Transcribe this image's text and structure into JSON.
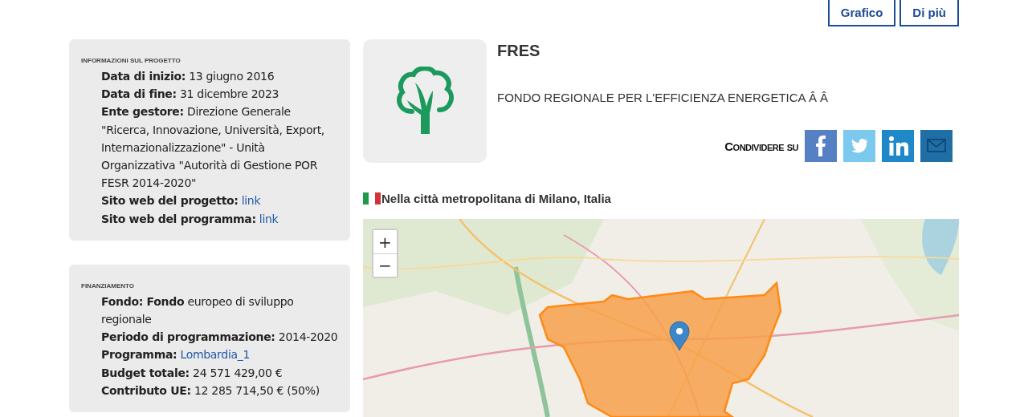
{
  "header_buttons": [
    "Grafico",
    "Di più"
  ],
  "project_info": {
    "heading": "INFORMAZIONI SUL PROGETTO",
    "rows": [
      {
        "kind": "text",
        "text": "**Data di inizio:** 13 giugno 2016"
      },
      {
        "kind": "text",
        "text": "**Data di fine:** 31 dicembre 2023"
      },
      {
        "kind": "text",
        "text": "**Ente gestore:** Direzione Generale \"Ricerca, Innovazione, Università, Export, Internazionalizzazione\" - Unità Organizzativa \"Autorità di Gestione POR FESR 2014-2020\""
      },
      {
        "kind": "link",
        "text": "**Sito web del progetto:**",
        "link": "link"
      },
      {
        "kind": "link",
        "text": "**Sito web del programma:**",
        "link": "link"
      }
    ]
  },
  "funding": {
    "heading": "FINANZIAMENTO",
    "rows": [
      {
        "kind": "text",
        "text": "**Fondo: Fondo** europeo di sviluppo regionale"
      },
      {
        "kind": "text",
        "text": "**Periodo di programmazione:** 2014-2020"
      },
      {
        "kind": "link",
        "text": "**Programma:**",
        "link": "Lombardia_1"
      },
      {
        "kind": "text",
        "text": "**Budget totale:** 24 571 429,00 €"
      },
      {
        "kind": "text",
        "text": "**Contributo UE:** 12 285 714,50 € (50%)"
      }
    ]
  },
  "project": {
    "title": "FRES",
    "description": "FONDO REGIONALE PER L'EFFICIENZA ENERGETICA Â Â"
  },
  "share": {
    "label": "Condividere su",
    "networks": [
      {
        "kind": "facebook"
      },
      {
        "kind": "twitter"
      },
      {
        "kind": "linkedin"
      },
      {
        "kind": "email"
      }
    ]
  },
  "location": {
    "text": "Nella città metropolitana di Milano, Italia"
  },
  "map": {
    "kind": "picture",
    "zoom_in": "+",
    "zoom_out": "−"
  }
}
